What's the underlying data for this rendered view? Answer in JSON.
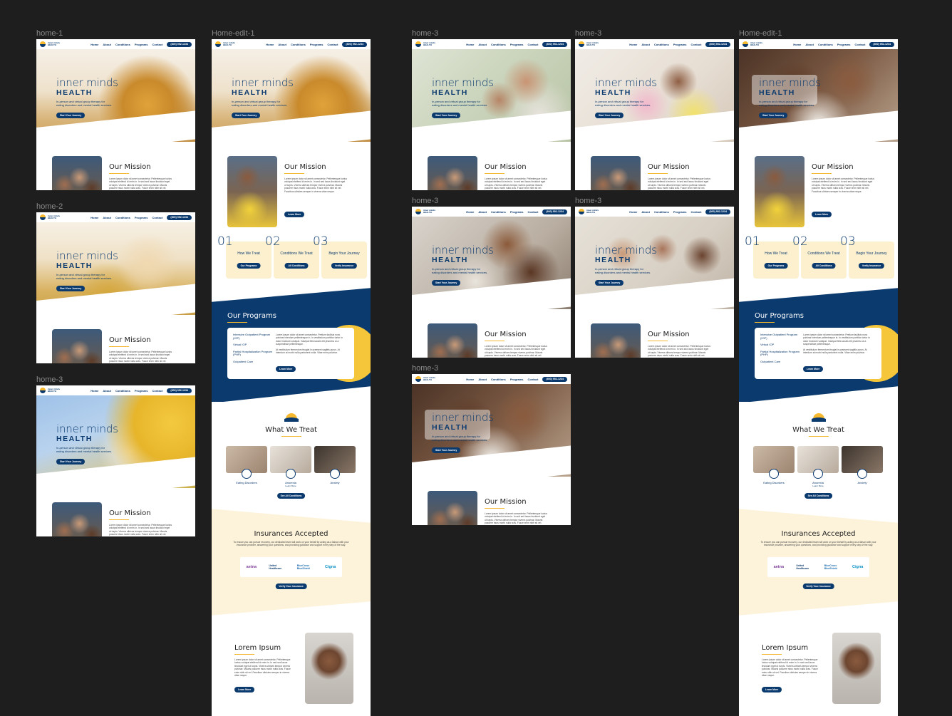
{
  "canvas": {
    "background": "#1e1e1e"
  },
  "frames": [
    {
      "id": "f1",
      "label": "home-1",
      "hero_image": "sunflower-woman-back",
      "variant": "standard"
    },
    {
      "id": "f2",
      "label": "home-2",
      "hero_image": "sunflower-woman-hat",
      "variant": "standard"
    },
    {
      "id": "f3",
      "label": "home-3",
      "hero_image": "sunflower-woman-dress",
      "variant": "standard"
    },
    {
      "id": "f4",
      "label": "Home-edit-1",
      "hero_image": "sunflower-woman-back",
      "variant": "full"
    },
    {
      "id": "f5",
      "label": "home-3",
      "hero_image": "smiling-couple",
      "variant": "standard"
    },
    {
      "id": "f6",
      "label": "home-3",
      "hero_image": "hugging-couple",
      "variant": "standard"
    },
    {
      "id": "f7",
      "label": "Home-edit-1",
      "hero_image": "laughing-friends",
      "variant": "full-glass"
    },
    {
      "id": "f8",
      "label": "home-3",
      "hero_image": "laughing-couple",
      "variant": "standard"
    },
    {
      "id": "f9",
      "label": "home-3",
      "hero_image": "group-of-friends",
      "variant": "standard"
    },
    {
      "id": "f10",
      "label": "home-3",
      "hero_image": "laughing-friends",
      "variant": "glass"
    }
  ],
  "header": {
    "logo_text": "inner minds\nHEALTH",
    "nav": [
      "Home",
      "About",
      "Conditions",
      "Programs",
      "Contact"
    ],
    "phone": "(800) 952-1234"
  },
  "hero": {
    "title": "inner minds",
    "title_bold": "HEALTH",
    "subtitle": "In-person and virtual group therapy for eating disorders and mental health services.",
    "cta": "Start Your Journey"
  },
  "mission": {
    "title": "Our Mission",
    "text": "Lorem ipsum dolor sit amet consectetur. Pellentesque luctus volutpat eleifend id enim in. In sed sed lacus tincidunt eget ut turpis. Viverra ultrices tempor viverra pulvinar. Mauris posuere risus morbi nulla cras. Fusce enim nibh sit vel. Faucibus ultricies semper in viverra vitae neque.",
    "cta": "Learn More"
  },
  "steps": [
    {
      "num": "01",
      "title": "How We Treat",
      "cta": "Our Programs"
    },
    {
      "num": "02",
      "title": "Conditions We Treat",
      "cta": "All Conditions"
    },
    {
      "num": "03",
      "title": "Begin Your Journey",
      "cta": "Verify Insurance"
    }
  ],
  "programs": {
    "title": "Our Programs",
    "items": [
      "Intensive Outpatient Program (IOP)",
      "Virtual IOP",
      "Partial Hospitalization Program (PHP)",
      "Outpatient Care"
    ],
    "desc1": "Lorem ipsum dolor sit amet consectetur. Pretium facilisis nunc pulvinar interdum pellentesque in. In vestibulum porttitor tortor in dolor tincidunt volutpat. Volutpat felis iaculis elit pharetra ut a suspendisse pellentesque.",
    "desc2": "At vestibulum fermentum feugiat in praesent sagittis purus. At interdum at morbi nulla parturient nulla. Vitae enim pulvinar.",
    "cta": "Learn More"
  },
  "treat": {
    "title": "What We Treat",
    "items": [
      "Eating Disorders",
      "Anorexia",
      "Anxiety"
    ],
    "sub": "Learn More",
    "cta": "See All Conditions"
  },
  "insurance": {
    "title": "Insurances Accepted",
    "text": "To ensure you can pursue recovery, our dedicated team will work on your behalf by acting as a liaison with your insurance provider, answering your questions, and providing guidance and support every step of the way.",
    "logos": [
      {
        "name": "aetna",
        "color": "#7d3f98"
      },
      {
        "name": "United Healthcare",
        "color": "#0b3a6e"
      },
      {
        "name": "BlueCross BlueShield",
        "color": "#1f6fb2"
      },
      {
        "name": "Cigna",
        "color": "#0a8fc7"
      }
    ],
    "cta": "Verify Your Insurance"
  },
  "lorem": {
    "title": "Lorem Ipsum",
    "text": "Lorem ipsum dolor sit amet consectetur. Pellentesque luctus volutpat eleifend id enim in. In sed sed lacus tincidunt eget ut turpis. Viverra ultrices tempor viverra pulvinar. Mauris posuere risus morbi nulla cras. Fusce enim nibh sit vel. Faucibus ultricies semper in viverra vitae neque.",
    "cta": "Learn More"
  },
  "colors": {
    "navy": "#0b3a6e",
    "gold": "#f5b82e",
    "cream": "#fdf3db"
  }
}
